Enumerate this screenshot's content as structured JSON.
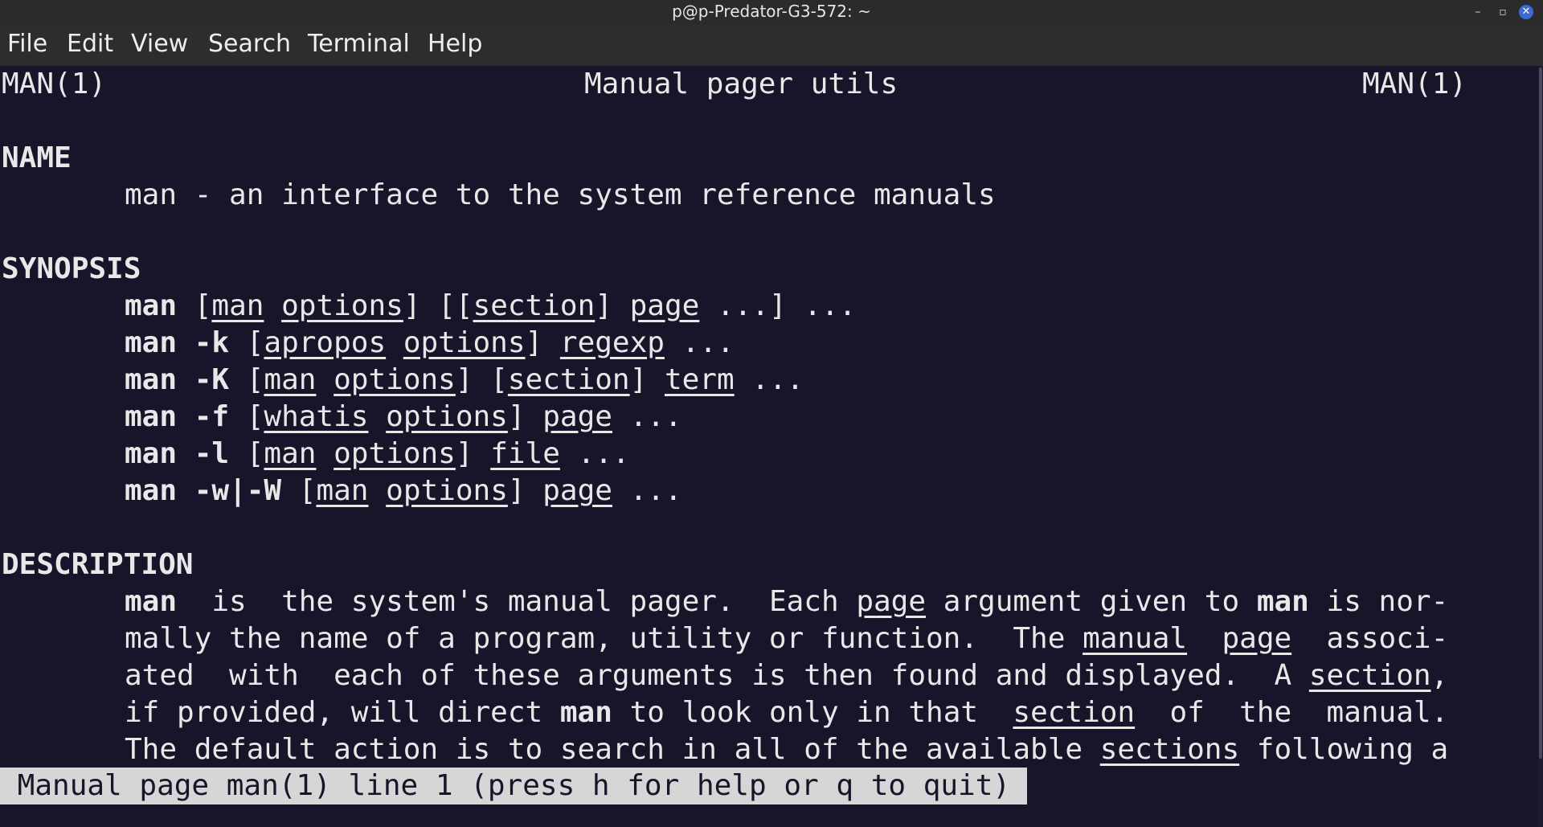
{
  "window": {
    "title": "p@p-Predator-G3-572: ~",
    "min_glyph": "–",
    "max_glyph": "▫",
    "close_glyph": "✕"
  },
  "menu": {
    "file": "File",
    "edit": "Edit",
    "view": "View",
    "search": "Search",
    "terminal": "Terminal",
    "help": "Help"
  },
  "page": {
    "header_left": "MAN(1)",
    "header_center": "Manual pager utils",
    "header_right": "MAN(1)",
    "name_heading": "NAME",
    "name_text": "man - an interface to the system reference manuals",
    "synopsis_heading": "SYNOPSIS",
    "synopsis": [
      {
        "cmd": "man",
        "t1": " [",
        "u1": "man",
        "t2": " ",
        "u2": "options",
        "t3": "] [[",
        "u3": "section",
        "t4": "] ",
        "u4": "page",
        "t5": " ...] ..."
      },
      {
        "cmd": "man -k",
        "t1": " [",
        "u1": "apropos",
        "t2": " ",
        "u2": "options",
        "t3": "] ",
        "u3": "regexp",
        "t4": " ..."
      },
      {
        "cmd": "man -K",
        "t1": " [",
        "u1": "man",
        "t2": " ",
        "u2": "options",
        "t3": "] [",
        "u3": "section",
        "t4": "] ",
        "u4": "term",
        "t5": " ..."
      },
      {
        "cmd": "man -f",
        "t1": " [",
        "u1": "whatis",
        "t2": " ",
        "u2": "options",
        "t3": "] ",
        "u3": "page",
        "t4": " ..."
      },
      {
        "cmd": "man -l",
        "t1": " [",
        "u1": "man",
        "t2": " ",
        "u2": "options",
        "t3": "] ",
        "u3": "file",
        "t4": " ..."
      },
      {
        "cmd": "man -w|-W",
        "t1": " [",
        "u1": "man",
        "t2": " ",
        "u2": "options",
        "t3": "] ",
        "u3": "page",
        "t4": " ..."
      }
    ],
    "description_heading": "DESCRIPTION",
    "desc": {
      "l1_b1": "man",
      "l1_t1": "  is  the system's manual pager.  Each ",
      "l1_u1": "page",
      "l1_t2": " argument given to ",
      "l1_b2": "man",
      "l1_t3": " is nor-",
      "l2_t1": "mally the name of a program, utility or function.  The ",
      "l2_u1": "manual",
      "l2_t2": "  ",
      "l2_u2": "page",
      "l2_t3": "  associ-",
      "l3_t1": "ated  with  each of these arguments is then found and displayed.  A ",
      "l3_u1": "section",
      "l3_t2": ",",
      "l4_t1": "if provided, will direct ",
      "l4_b1": "man",
      "l4_t2": " to look only in that  ",
      "l4_u1": "section",
      "l4_t3": "  of  the  manual.",
      "l5_t1": "The default action is to search in all of the available ",
      "l5_u1": "sections",
      "l5_t2": " following a"
    },
    "status": " Manual page man(1) line 1 (press h for help or q to quit)"
  },
  "colors": {
    "background": "#16152a",
    "foreground": "#e8e8e8",
    "status_bg": "#d6d6d6",
    "close_button": "#3b6bd1"
  }
}
